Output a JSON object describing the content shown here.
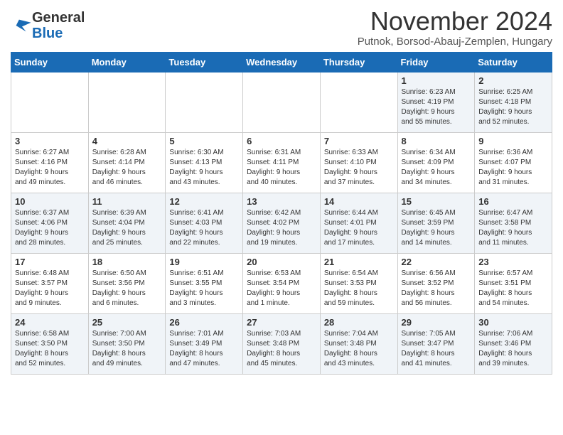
{
  "header": {
    "logo_general": "General",
    "logo_blue": "Blue",
    "title": "November 2024",
    "location": "Putnok, Borsod-Abauj-Zemplen, Hungary"
  },
  "days_of_week": [
    "Sunday",
    "Monday",
    "Tuesday",
    "Wednesday",
    "Thursday",
    "Friday",
    "Saturday"
  ],
  "weeks": [
    [
      {
        "day": null,
        "info": null
      },
      {
        "day": null,
        "info": null
      },
      {
        "day": null,
        "info": null
      },
      {
        "day": null,
        "info": null
      },
      {
        "day": null,
        "info": null
      },
      {
        "day": "1",
        "info": "Sunrise: 6:23 AM\nSunset: 4:19 PM\nDaylight: 9 hours\nand 55 minutes."
      },
      {
        "day": "2",
        "info": "Sunrise: 6:25 AM\nSunset: 4:18 PM\nDaylight: 9 hours\nand 52 minutes."
      }
    ],
    [
      {
        "day": "3",
        "info": "Sunrise: 6:27 AM\nSunset: 4:16 PM\nDaylight: 9 hours\nand 49 minutes."
      },
      {
        "day": "4",
        "info": "Sunrise: 6:28 AM\nSunset: 4:14 PM\nDaylight: 9 hours\nand 46 minutes."
      },
      {
        "day": "5",
        "info": "Sunrise: 6:30 AM\nSunset: 4:13 PM\nDaylight: 9 hours\nand 43 minutes."
      },
      {
        "day": "6",
        "info": "Sunrise: 6:31 AM\nSunset: 4:11 PM\nDaylight: 9 hours\nand 40 minutes."
      },
      {
        "day": "7",
        "info": "Sunrise: 6:33 AM\nSunset: 4:10 PM\nDaylight: 9 hours\nand 37 minutes."
      },
      {
        "day": "8",
        "info": "Sunrise: 6:34 AM\nSunset: 4:09 PM\nDaylight: 9 hours\nand 34 minutes."
      },
      {
        "day": "9",
        "info": "Sunrise: 6:36 AM\nSunset: 4:07 PM\nDaylight: 9 hours\nand 31 minutes."
      }
    ],
    [
      {
        "day": "10",
        "info": "Sunrise: 6:37 AM\nSunset: 4:06 PM\nDaylight: 9 hours\nand 28 minutes."
      },
      {
        "day": "11",
        "info": "Sunrise: 6:39 AM\nSunset: 4:04 PM\nDaylight: 9 hours\nand 25 minutes."
      },
      {
        "day": "12",
        "info": "Sunrise: 6:41 AM\nSunset: 4:03 PM\nDaylight: 9 hours\nand 22 minutes."
      },
      {
        "day": "13",
        "info": "Sunrise: 6:42 AM\nSunset: 4:02 PM\nDaylight: 9 hours\nand 19 minutes."
      },
      {
        "day": "14",
        "info": "Sunrise: 6:44 AM\nSunset: 4:01 PM\nDaylight: 9 hours\nand 17 minutes."
      },
      {
        "day": "15",
        "info": "Sunrise: 6:45 AM\nSunset: 3:59 PM\nDaylight: 9 hours\nand 14 minutes."
      },
      {
        "day": "16",
        "info": "Sunrise: 6:47 AM\nSunset: 3:58 PM\nDaylight: 9 hours\nand 11 minutes."
      }
    ],
    [
      {
        "day": "17",
        "info": "Sunrise: 6:48 AM\nSunset: 3:57 PM\nDaylight: 9 hours\nand 9 minutes."
      },
      {
        "day": "18",
        "info": "Sunrise: 6:50 AM\nSunset: 3:56 PM\nDaylight: 9 hours\nand 6 minutes."
      },
      {
        "day": "19",
        "info": "Sunrise: 6:51 AM\nSunset: 3:55 PM\nDaylight: 9 hours\nand 3 minutes."
      },
      {
        "day": "20",
        "info": "Sunrise: 6:53 AM\nSunset: 3:54 PM\nDaylight: 9 hours\nand 1 minute."
      },
      {
        "day": "21",
        "info": "Sunrise: 6:54 AM\nSunset: 3:53 PM\nDaylight: 8 hours\nand 59 minutes."
      },
      {
        "day": "22",
        "info": "Sunrise: 6:56 AM\nSunset: 3:52 PM\nDaylight: 8 hours\nand 56 minutes."
      },
      {
        "day": "23",
        "info": "Sunrise: 6:57 AM\nSunset: 3:51 PM\nDaylight: 8 hours\nand 54 minutes."
      }
    ],
    [
      {
        "day": "24",
        "info": "Sunrise: 6:58 AM\nSunset: 3:50 PM\nDaylight: 8 hours\nand 52 minutes."
      },
      {
        "day": "25",
        "info": "Sunrise: 7:00 AM\nSunset: 3:50 PM\nDaylight: 8 hours\nand 49 minutes."
      },
      {
        "day": "26",
        "info": "Sunrise: 7:01 AM\nSunset: 3:49 PM\nDaylight: 8 hours\nand 47 minutes."
      },
      {
        "day": "27",
        "info": "Sunrise: 7:03 AM\nSunset: 3:48 PM\nDaylight: 8 hours\nand 45 minutes."
      },
      {
        "day": "28",
        "info": "Sunrise: 7:04 AM\nSunset: 3:48 PM\nDaylight: 8 hours\nand 43 minutes."
      },
      {
        "day": "29",
        "info": "Sunrise: 7:05 AM\nSunset: 3:47 PM\nDaylight: 8 hours\nand 41 minutes."
      },
      {
        "day": "30",
        "info": "Sunrise: 7:06 AM\nSunset: 3:46 PM\nDaylight: 8 hours\nand 39 minutes."
      }
    ]
  ]
}
